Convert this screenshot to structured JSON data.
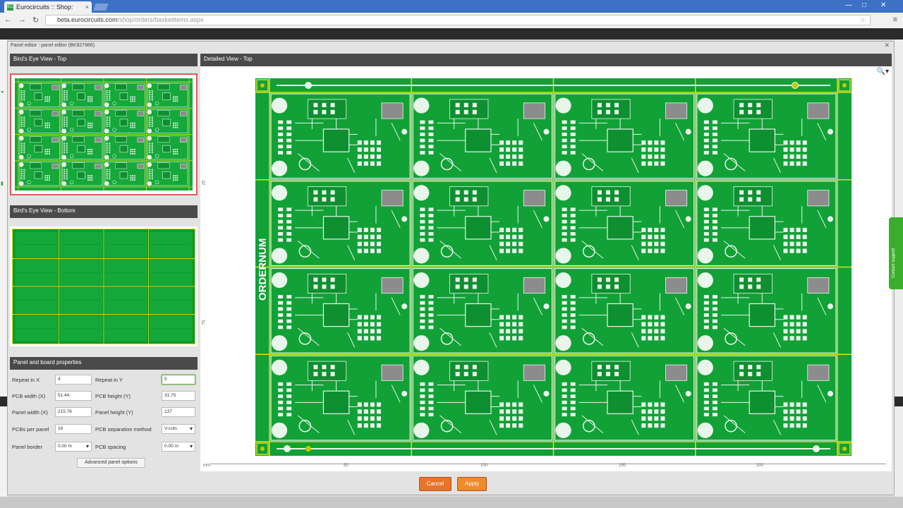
{
  "browser": {
    "tab_title": "Eurocircuits :: Shop:",
    "tab_close": "×",
    "url_host": "beta.eurocircuits.com",
    "url_path": "/shop/orders/basketitems.aspx",
    "win_min": "—",
    "win_max": "□",
    "win_close": "✕"
  },
  "dialog": {
    "title": "Panel editor : panel editor (BK927986)",
    "close": "✕"
  },
  "sections": {
    "birds_eye_top": "Bird's Eye View - Top",
    "birds_eye_bottom": "Bird's Eye View - Bottom",
    "detailed_view": "Detailed View - Top",
    "properties": "Panel and board properties"
  },
  "properties": {
    "repeat_x_label": "Repeat in X",
    "repeat_x_value": "4",
    "repeat_y_label": "Repeat in Y",
    "repeat_y_value": "5",
    "pcb_width_label": "PCB width (X)",
    "pcb_width_value": "51.44",
    "pcb_height_label": "PCB height (Y)",
    "pcb_height_value": "31.75",
    "panel_width_label": "Panel width (X)",
    "panel_width_value": "215.76",
    "panel_height_label": "Panel height (Y)",
    "panel_height_value": "137",
    "pcbs_per_panel_label": "PCBs per panel",
    "pcbs_per_panel_value": "16",
    "separation_label": "PCB separation method",
    "separation_value": "V-cuts",
    "panel_border_label": "Panel border",
    "panel_border_value": "0.00 m",
    "pcb_spacing_label": "PCB spacing",
    "pcb_spacing_value": "0.00 m",
    "advanced_button": "Advanced panel options"
  },
  "detail": {
    "panel_label": "ORDERNUM",
    "x_ticks": [
      "mm",
      "50",
      "100",
      "150",
      "200"
    ],
    "y_ticks": [
      "25",
      "75"
    ],
    "zoom_icon": "🔍▾",
    "grid_cols": 4,
    "grid_rows": 4
  },
  "buttons": {
    "cancel": "Cancel",
    "apply": "Apply"
  },
  "side_tab": "Contact support",
  "colors": {
    "pcb_green": "#11a137",
    "trace_white": "#e8f5ea",
    "vcut_yellow": "#d8e020",
    "accent_orange": "#e8742c",
    "selection_red": "#e05a5a"
  }
}
